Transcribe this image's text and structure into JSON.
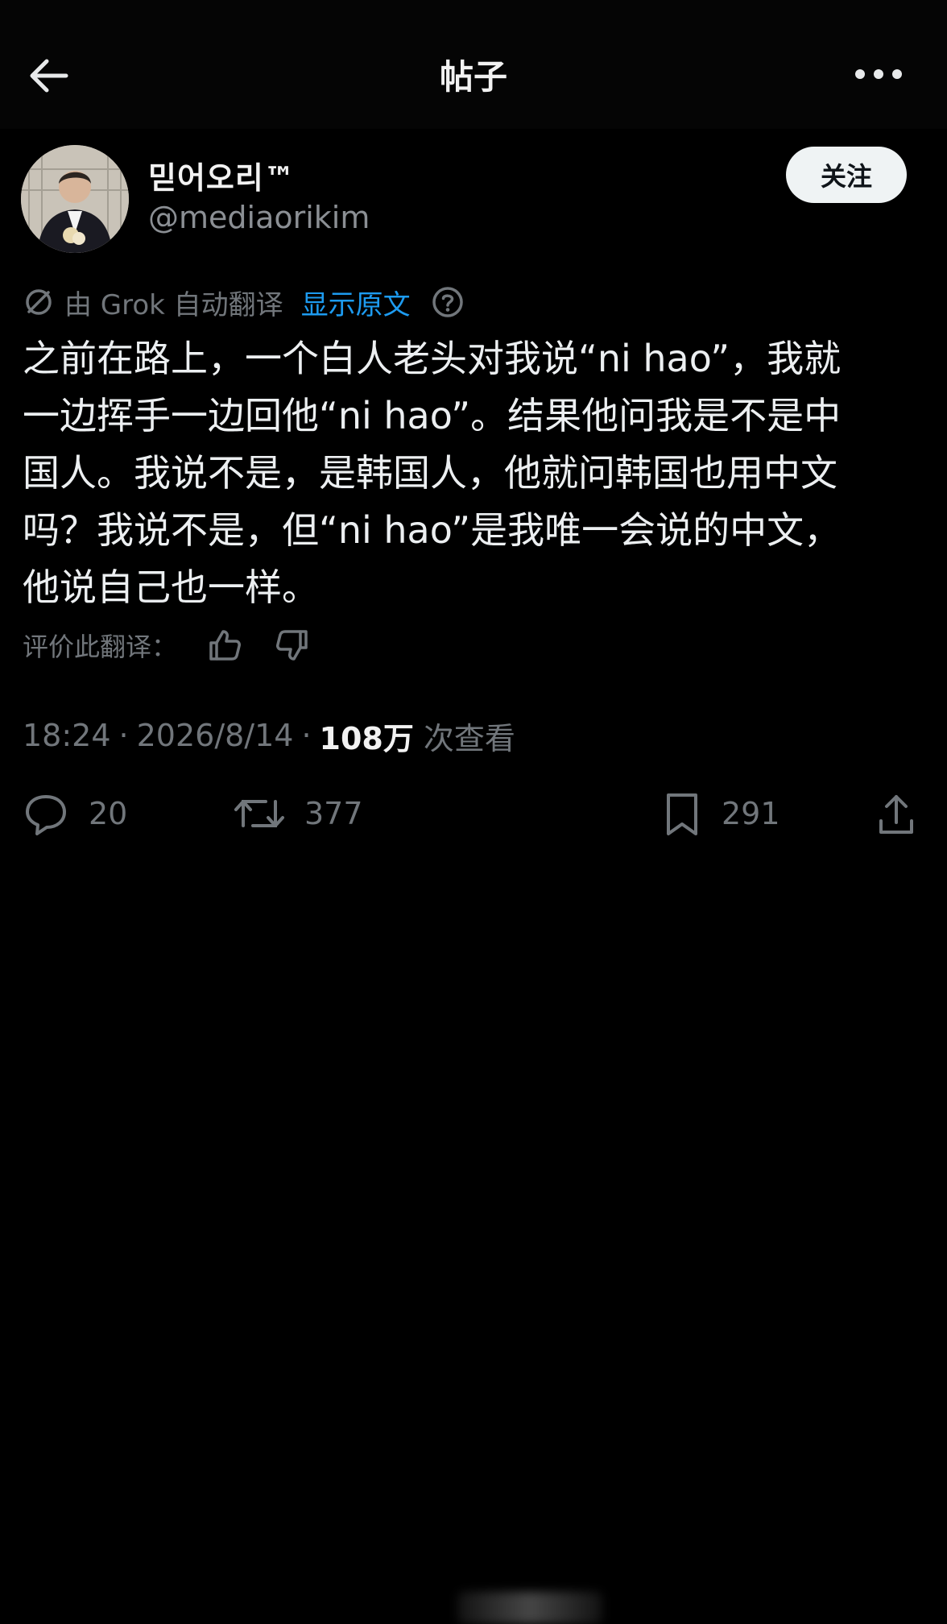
{
  "header": {
    "title": "帖子",
    "back_icon": "arrow-left-icon",
    "more_icon": "more-horizontal-icon"
  },
  "author": {
    "display_name": "믿어오리™",
    "handle": "@mediaorikim",
    "follow_label": "关注"
  },
  "translation": {
    "prefix": "由 Grok 自动翻译",
    "show_original_label": "显示原文",
    "rate_label": "评价此翻译："
  },
  "post": {
    "text": "之前在路上，一个白人老头对我说“ni hao”，我就\n一边挥手一边回他“ni hao”。结果他问我是不是中\n国人。我说不是，是韩国人，他就问韩国也用中文\n吗？我说不是，但“ni hao”是我唯一会说的中文，\n他说自己也一样。",
    "time": "18:24",
    "separator": "·",
    "date": "2026/8/14",
    "views_count": "108万",
    "views_label": "次查看"
  },
  "actions": {
    "replies": "20",
    "reposts": "377",
    "bookmarks": "291"
  },
  "colors": {
    "background": "#000000",
    "text_primary": "#e7e9ea",
    "text_secondary": "#71767b",
    "link": "#1d9bf0",
    "follow_bg": "#eff3f4"
  }
}
